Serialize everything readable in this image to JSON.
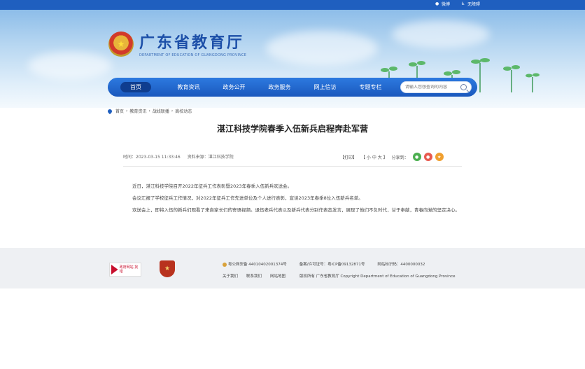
{
  "topbar": {
    "weibo": "微博",
    "accessible": "无障碍"
  },
  "header": {
    "site_name": "广东省教育厅",
    "site_name_en": "DEPARTMENT OF EDUCATION OF GUANGDONG PROVINCE"
  },
  "nav": {
    "items": [
      "首页",
      "教育资讯",
      "政务公开",
      "政务服务",
      "网上信访",
      "专题专栏"
    ],
    "search_placeholder": "请输入您想查询的内容"
  },
  "breadcrumb": [
    "首页",
    "教育资讯",
    "战线联播",
    "高校动态"
  ],
  "article": {
    "title": "湛江科技学院春季入伍新兵启程奔赴军营",
    "time_label": "时间：",
    "time": "2023-03-15 11:33:46",
    "source_label": "资料来源：",
    "source": "湛江科技学院",
    "print": "【打印】",
    "font_size": "【 小  中  大 】",
    "share_label": "分享到：",
    "paragraphs": [
      "近日，湛江科技学院召开2022年征兵工作表彰暨2023年春季入伍新兵欢送会。",
      "会议汇报了学校征兵工作情况，对2022年征兵工作先进单位及个人进行表彰，宣读2023年春季8位入伍新兵名单。",
      "欢送会上，即将入伍的新兵们观看了来自家长们的寄语视频。退伍老兵代表以及新兵代表分别作表态发言，展现了他们不负时代，甘于奉献，青春向党的坚定决心。"
    ]
  },
  "footer": {
    "logo1_text": "政府网站 找错",
    "police": "粤公网安备 44010402001374号",
    "icp_label": "备案/许可证号：",
    "icp": "粤ICP备09132871号",
    "site_code_label": "网站标识码：",
    "site_code": "4400000032",
    "links": [
      "关于我们",
      "联系我们",
      "网站地图"
    ],
    "copyright": "版权所有 广东省教育厅 Copyright Department of Education of Guangdong Province"
  },
  "colors": {
    "primary": "#1f5fbf",
    "nav_active": "#0f3d8f",
    "footer_bg": "#eef0f3"
  }
}
